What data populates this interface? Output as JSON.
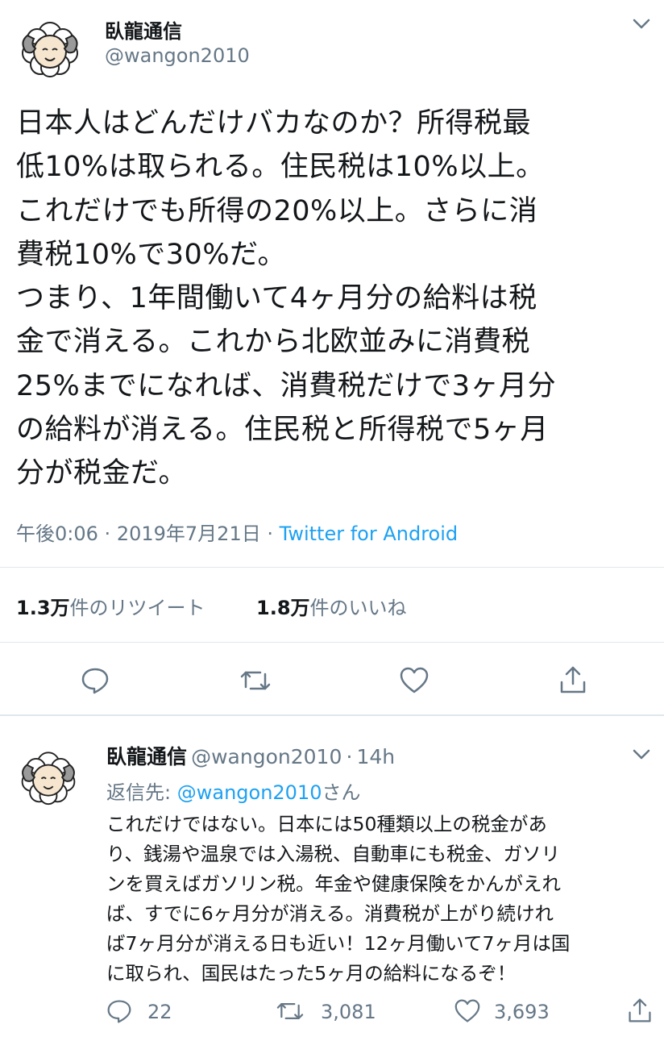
{
  "tweet": {
    "author_name": "臥龍通信",
    "author_handle": "@wangon2010",
    "text_lines": [
      "日本人はどんだけバカなのか？所得税最",
      "低10%は取られる。住民税は10%以上。",
      "これだけでも所得の20%以上。さらに消",
      "費税10%で30%だ。",
      "つまり、1年間働いて4ヶ月分の給料は税",
      "金で消える。これから北欧並みに消費税",
      "25%までになれば、消費税だけで3ヶ月分",
      "の給料が消える。住民税と所得税で5ヶ月",
      "分が税金だ。"
    ],
    "time": "午後0:06",
    "separator": "·",
    "date": "2019年7月21日",
    "source": "Twitter for Android",
    "retweets": {
      "count": "1.3万",
      "unit": "件の",
      "label": "リツイート"
    },
    "likes": {
      "count": "1.8万",
      "unit": "件の",
      "label": "いいね"
    },
    "icons": [
      "reply-icon",
      "retweet-icon",
      "like-icon",
      "share-icon",
      "chevron-down-icon"
    ]
  },
  "reply": {
    "author_name": "臥龍通信",
    "author_handle": "@wangon2010",
    "separator": "·",
    "age": "14h",
    "reply_to_prefix": "返信先:",
    "reply_to_mention": "@wangon2010",
    "reply_to_suffix": "さん",
    "text_lines": [
      "これだけではない。日本には50種類以上の税金があ",
      "り、銭湯や温泉では入湯税、自動車にも税金、ガソリ",
      "ンを買えばガソリン税。年金や健康保険をかんがえれ",
      "ば、すでに6ヶ月分が消える。消費税が上がり続けれ",
      "ば7ヶ月分が消える日も近い！12ヶ月働いて7ヶ月は国",
      "に取られ、国民はたった5ヶ月の給料になるぞ！"
    ],
    "reply_count": "22",
    "retweet_count": "3,081",
    "like_count": "3,693"
  },
  "colors": {
    "text": "#14171a",
    "secondary": "#657786",
    "link": "#1da1f2",
    "divider": "#e1e8ed"
  }
}
